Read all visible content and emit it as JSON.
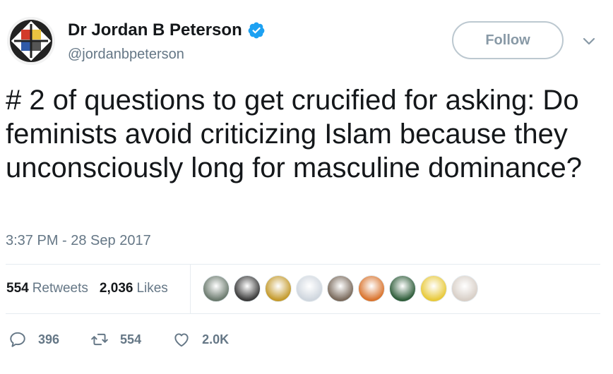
{
  "author": {
    "display_name": "Dr Jordan B Peterson",
    "handle": "@jordanbpeterson",
    "verified": true,
    "avatar_icon": "profile-avatar"
  },
  "follow_button": {
    "label": "Follow"
  },
  "menu": {
    "icon": "chevron-down-icon"
  },
  "tweet": {
    "text": "# 2 of questions to get crucified for asking: Do feminists avoid criticizing Islam because they unconsciously long for masculine dominance?",
    "timestamp": "3:37 PM - 28 Sep 2017"
  },
  "stats": {
    "retweets_count": "554",
    "retweets_label": "Retweets",
    "likes_count": "2,036",
    "likes_label": "Likes"
  },
  "likers": [
    {
      "icon": "liker-avatar",
      "color": "#6b7a6e"
    },
    {
      "icon": "liker-avatar",
      "color": "#3b3b3b"
    },
    {
      "icon": "liker-avatar",
      "color": "#c49a2c"
    },
    {
      "icon": "liker-avatar",
      "color": "#cfd6de"
    },
    {
      "icon": "liker-avatar",
      "color": "#7a6a5c"
    },
    {
      "icon": "liker-avatar",
      "color": "#d9742e"
    },
    {
      "icon": "liker-avatar",
      "color": "#2f5d3a"
    },
    {
      "icon": "liker-avatar",
      "color": "#e8c93a"
    },
    {
      "icon": "liker-avatar",
      "color": "#d8cfc7"
    }
  ],
  "actions": {
    "reply": {
      "icon": "reply-icon",
      "count": "396"
    },
    "retweet": {
      "icon": "retweet-icon",
      "count": "554"
    },
    "like": {
      "icon": "heart-icon",
      "count": "2.0K"
    }
  },
  "colors": {
    "text": "#14171a",
    "secondary": "#657786",
    "verified": "#1da1f2",
    "border": "#e6ecf0"
  }
}
